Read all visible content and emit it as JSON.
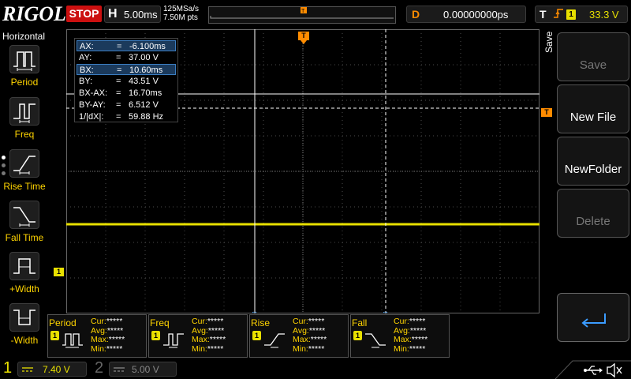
{
  "top": {
    "logo": "RIGOL",
    "run_state": "STOP",
    "timebase_letter": "H",
    "timebase": "5.00ms",
    "sample_rate": "125MSa/s",
    "memory_depth": "7.50M pts",
    "delay_letter": "D",
    "delay": "0.00000000ps",
    "trigger_letter": "T",
    "trigger_source": "1",
    "trigger_level": "33.3 V"
  },
  "sidebar": {
    "title": "Horizontal",
    "items": [
      {
        "label": "Period"
      },
      {
        "label": "Freq"
      },
      {
        "label": "Rise Time"
      },
      {
        "label": "Fall Time"
      },
      {
        "label": "+Width"
      },
      {
        "label": "-Width"
      }
    ]
  },
  "readout": [
    {
      "key": "AX:",
      "eq": "=",
      "value": "-6.100ms"
    },
    {
      "key": "AY:",
      "eq": "=",
      "value": "37.00 V"
    },
    {
      "key": "BX:",
      "eq": "=",
      "value": "10.60ms"
    },
    {
      "key": "BY:",
      "eq": "=",
      "value": "43.51 V"
    },
    {
      "key": "BX-AX:",
      "eq": "=",
      "value": "16.70ms"
    },
    {
      "key": "BY-AY:",
      "eq": "=",
      "value": "6.512 V"
    },
    {
      "key": "1/|dX|:",
      "eq": "=",
      "value": "59.88 Hz"
    }
  ],
  "markers": {
    "trigger_pos": "T",
    "trigger_level": "T",
    "ch1": "1"
  },
  "menu": {
    "title": "Save",
    "save": "Save",
    "new_file": "New File",
    "new_folder": "NewFolder",
    "delete": "Delete",
    "enter_icon": "enter-return-icon"
  },
  "measurements": [
    {
      "name": "Period",
      "ch": "1",
      "cur_label": "Cur:",
      "cur": "*****",
      "avg_label": "Avg:",
      "avg": "*****",
      "max_label": "Max:",
      "max": "*****",
      "min_label": "Min:",
      "min": "*****"
    },
    {
      "name": "Freq",
      "ch": "1",
      "cur_label": "Cur:",
      "cur": "*****",
      "avg_label": "Avg:",
      "avg": "*****",
      "max_label": "Max:",
      "max": "*****",
      "min_label": "Min:",
      "min": "*****"
    },
    {
      "name": "Rise",
      "ch": "1",
      "cur_label": "Cur:",
      "cur": "*****",
      "avg_label": "Avg:",
      "avg": "*****",
      "max_label": "Max:",
      "max": "*****",
      "min_label": "Min:",
      "min": "*****"
    },
    {
      "name": "Fall",
      "ch": "1",
      "cur_label": "Cur:",
      "cur": "*****",
      "avg_label": "Avg:",
      "avg": "*****",
      "max_label": "Max:",
      "max": "*****",
      "min_label": "Min:",
      "min": "*****"
    }
  ],
  "bottom": {
    "ch1_num": "1",
    "ch1_scale": "7.40 V",
    "ch2_num": "2",
    "ch2_scale": "5.00 V",
    "usb_icon": "usb-icon",
    "speaker_icon": "speaker-mute-icon"
  },
  "colors": {
    "ch1": "#e8e000",
    "trigger": "#ff8c00",
    "stop": "#cc1010",
    "grid": "#4a4a4a"
  }
}
